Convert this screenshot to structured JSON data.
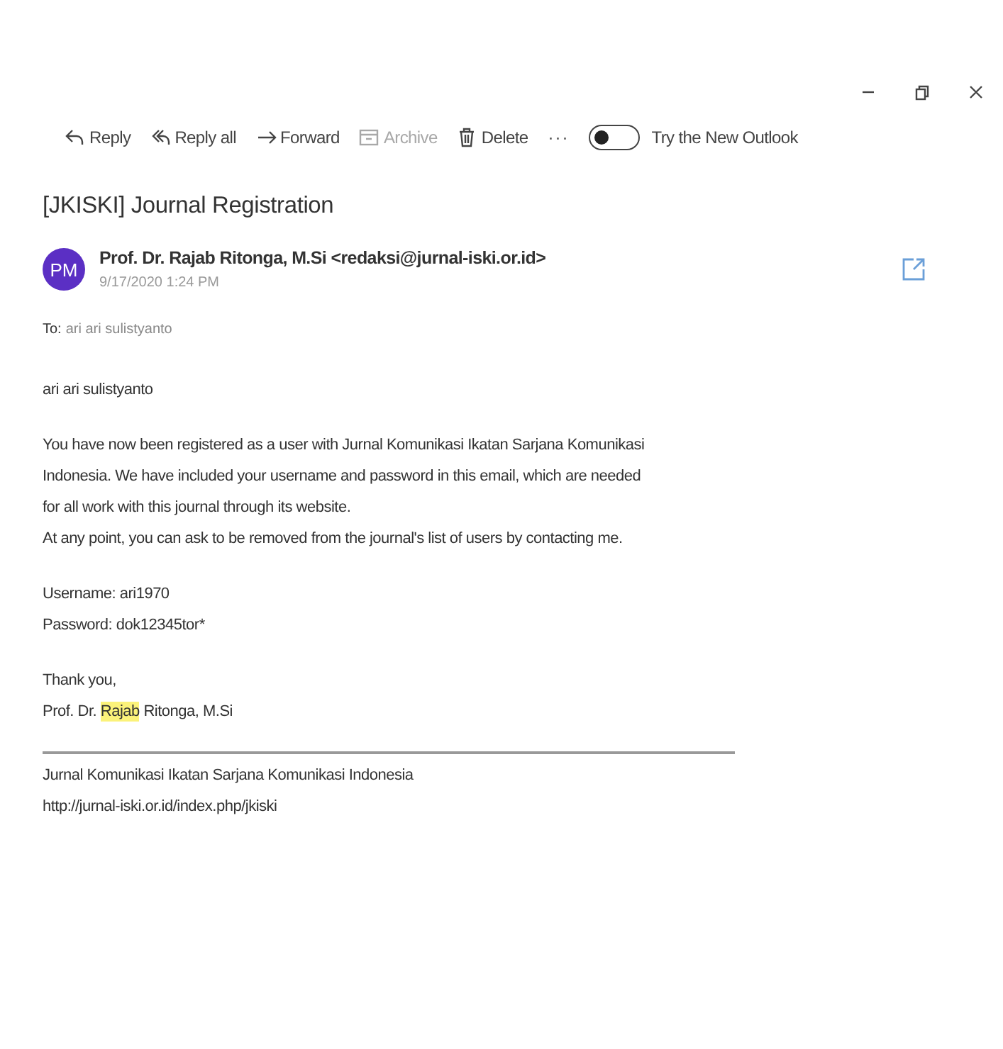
{
  "window": {
    "controls": [
      {
        "kind": "minimize"
      },
      {
        "kind": "restore"
      },
      {
        "kind": "close"
      }
    ]
  },
  "toolbar": {
    "actions": [
      {
        "kind": "reply",
        "label": "Reply",
        "disabled": false
      },
      {
        "kind": "reply-all",
        "label": "Reply all",
        "disabled": false
      },
      {
        "kind": "forward",
        "label": "Forward",
        "disabled": false
      },
      {
        "kind": "archive",
        "label": "Archive",
        "disabled": true
      },
      {
        "kind": "delete",
        "label": "Delete",
        "disabled": false
      }
    ],
    "more": "···",
    "new_outlook": {
      "label": "Try the New Outlook",
      "on": false
    }
  },
  "message": {
    "subject": "[JKISKI] Journal Registration",
    "avatar": {
      "initials": "PM",
      "color": "#5b2fc4"
    },
    "sender": "Prof. Dr. Rajab Ritonga, M.Si <redaksi@jurnal-iski.or.id>",
    "date": "9/17/2020 1:24 PM",
    "to_label": "To:",
    "to": "ari ari sulistyanto",
    "body": [
      {
        "kind": "text",
        "lines": [
          "ari ari sulistyanto"
        ]
      },
      {
        "kind": "text",
        "lines": [
          "You have now been registered as a user with Jurnal Komunikasi Ikatan Sarjana Komunikasi Indonesia. We have included your username and password in this email, which are needed for all work with this journal through its website.",
          "At any point, you can ask to be removed from the journal's list of users by contacting me."
        ]
      },
      {
        "kind": "text",
        "lines": [
          "Username: ari1970",
          "Password: dok12345tor*"
        ]
      },
      {
        "kind": "signature",
        "lines": [
          "Thank you,"
        ],
        "parts": [
          {
            "text": "Prof. Dr. ",
            "highlighted": false
          },
          {
            "text": "Rajab",
            "highlighted": true
          },
          {
            "text": " Ritonga, M.Si",
            "highlighted": false
          }
        ]
      },
      {
        "kind": "footer",
        "lines": [
          "Jurnal Komunikasi Ikatan Sarjana Komunikasi Indonesia",
          "http://jurnal-iski.or.id/index.php/jkiski"
        ]
      }
    ]
  }
}
